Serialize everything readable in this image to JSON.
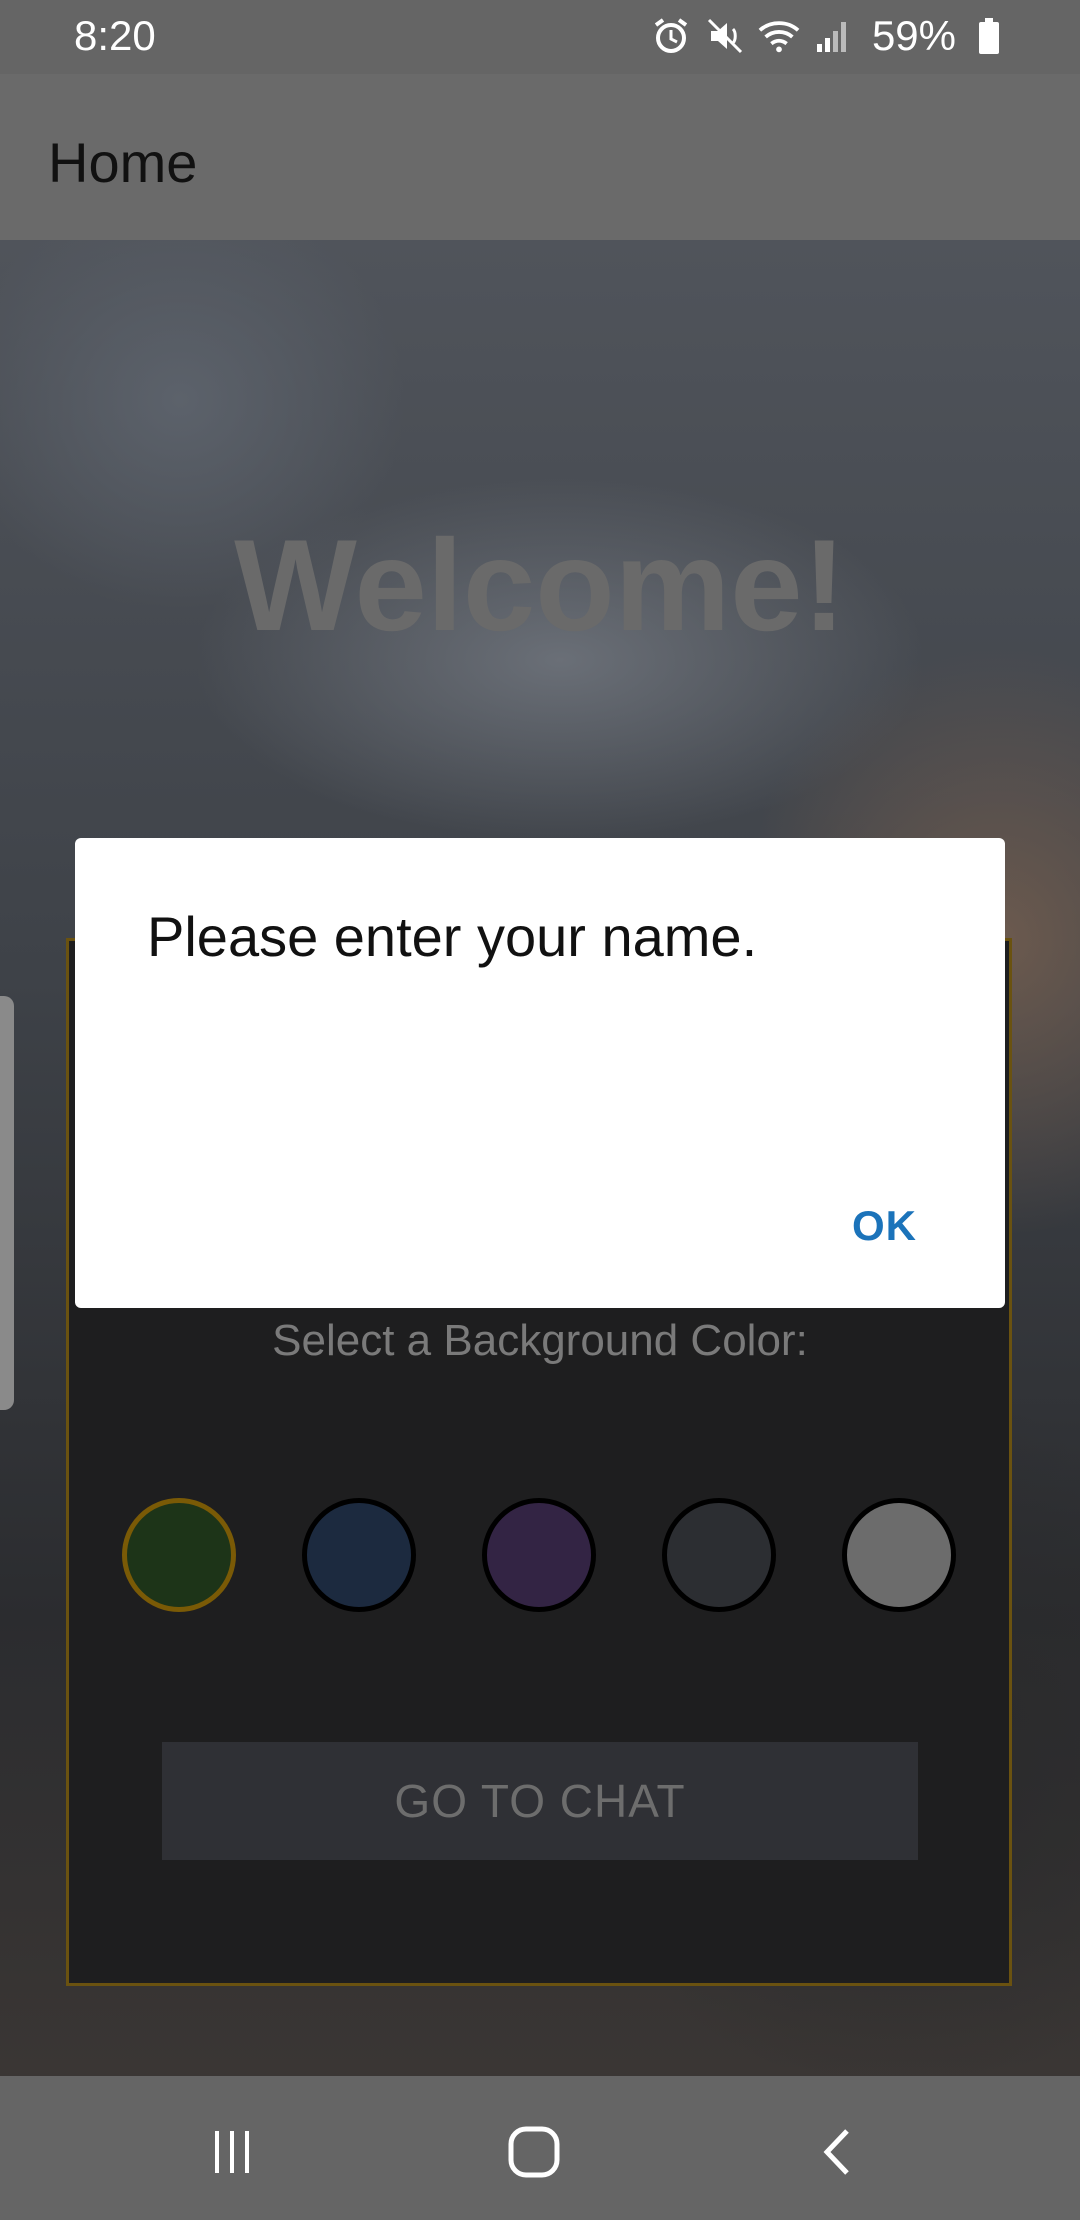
{
  "status_bar": {
    "time": "8:20",
    "battery_percent": "59%",
    "icons": [
      "alarm-icon",
      "mute-icon",
      "wifi-icon",
      "signal-icon",
      "battery-icon"
    ]
  },
  "app_bar": {
    "title": "Home"
  },
  "main": {
    "welcome_text": "Welcome!",
    "background_color_label": "Select a Background Color:",
    "color_options": [
      {
        "name": "green",
        "color": "#1d3418",
        "selected": true
      },
      {
        "name": "navy",
        "color": "#1c2a3f",
        "selected": false
      },
      {
        "name": "purple",
        "color": "#332444",
        "selected": false
      },
      {
        "name": "dark-gray",
        "color": "#2c2e32",
        "selected": false
      },
      {
        "name": "light-gray",
        "color": "#6c6c6c",
        "selected": false
      }
    ],
    "go_button_label": "GO TO CHAT"
  },
  "dialog": {
    "message": "Please enter your name.",
    "ok_label": "OK",
    "accent_color": "#1b73ba"
  },
  "nav_bar": {
    "buttons": [
      "recent-apps-icon",
      "home-icon",
      "back-icon"
    ]
  }
}
